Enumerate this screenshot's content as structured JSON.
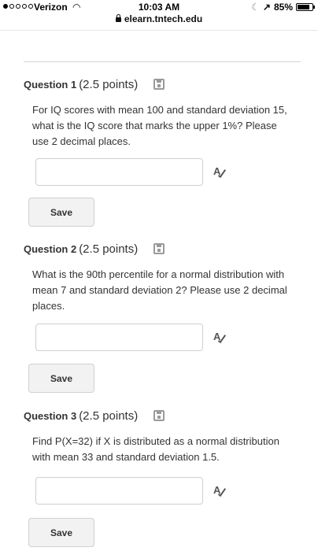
{
  "status_bar": {
    "carrier": "Verizon",
    "time": "10:03 AM",
    "battery": "85%",
    "battery_level": 0.85,
    "signal_bars": 1
  },
  "browser": {
    "url": "elearn.tntech.edu"
  },
  "questions": [
    {
      "title": "Question 1",
      "points": "(2.5 points)",
      "text": "For IQ scores with mean 100 and standard deviation 15, what is the IQ score that marks the upper 1%? Please use 2 decimal places.",
      "answer": "",
      "save_label": "Save"
    },
    {
      "title": "Question 2",
      "points": "(2.5 points)",
      "text": "What is the 90th percentile for a normal distribution with mean 7 and standard deviation 2? Please use 2 decimal places.",
      "answer": "",
      "save_label": "Save"
    },
    {
      "title": "Question 3",
      "points": "(2.5 points)",
      "text": "Find P(X=32) if X is distributed as a normal distribution with mean 33 and standard deviation 1.5.",
      "answer": "",
      "save_label": "Save"
    }
  ],
  "icons": {
    "save": "floppy-disk-icon",
    "spell_check": "spell-check-icon"
  }
}
